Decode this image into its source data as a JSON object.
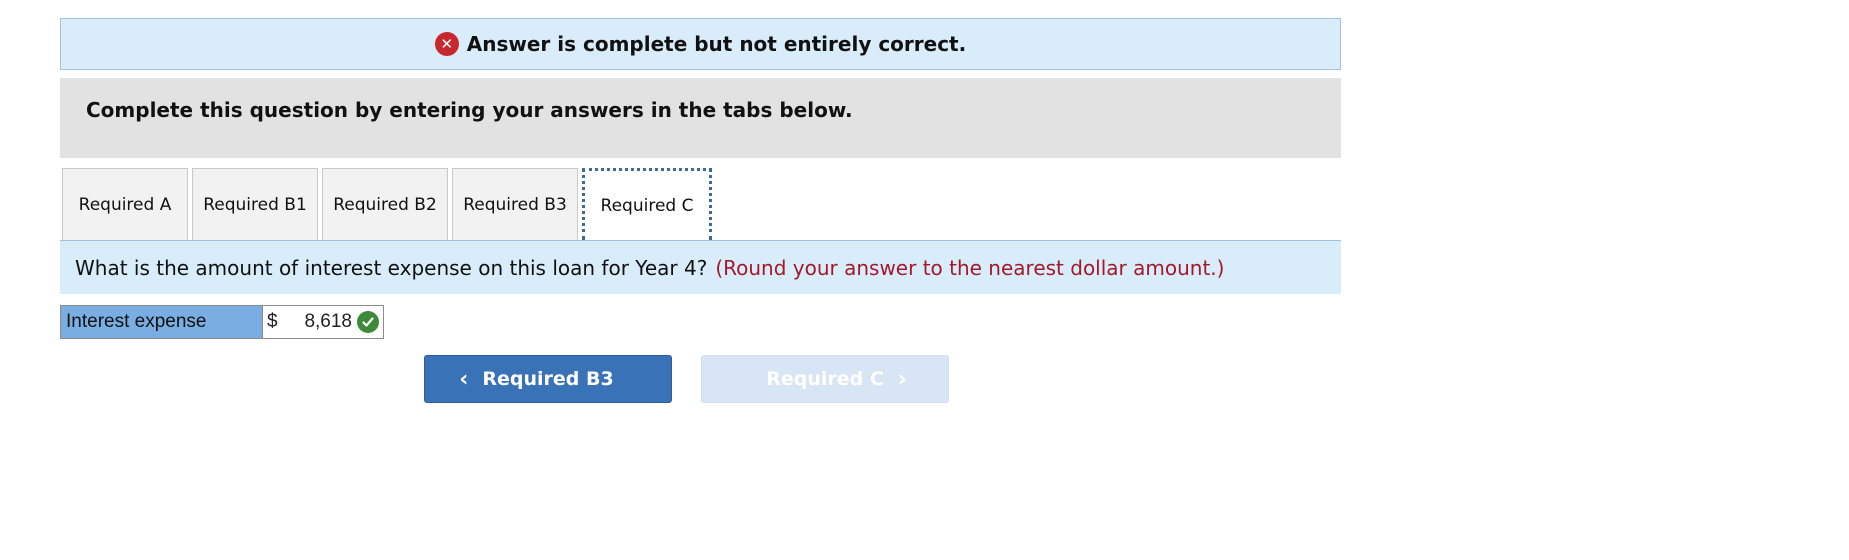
{
  "banner": {
    "message": "Answer is complete but not entirely correct."
  },
  "instructions": {
    "text": "Complete this question by entering your answers in the tabs below."
  },
  "tabs": [
    {
      "label": "Required A"
    },
    {
      "label": "Required B1"
    },
    {
      "label": "Required B2"
    },
    {
      "label": "Required B3"
    },
    {
      "label": "Required C",
      "active": true
    }
  ],
  "question": {
    "text": "What is the amount of interest expense on this loan for Year 4?",
    "hint": "(Round your answer to the nearest dollar amount.)"
  },
  "answer": {
    "label": "Interest expense",
    "currency": "$",
    "value": "8,618",
    "status": "correct"
  },
  "nav": {
    "prev_label": "Required B3",
    "next_label": "Required C"
  },
  "colors": {
    "banner_bg": "#d9ecf9",
    "error_icon": "#c7282d",
    "hint_text": "#a3192a",
    "label_bg": "#7aaee3",
    "check_icon": "#3c8a3a",
    "prev_button": "#3a72b8",
    "next_button_disabled": "#d7e5f4"
  }
}
